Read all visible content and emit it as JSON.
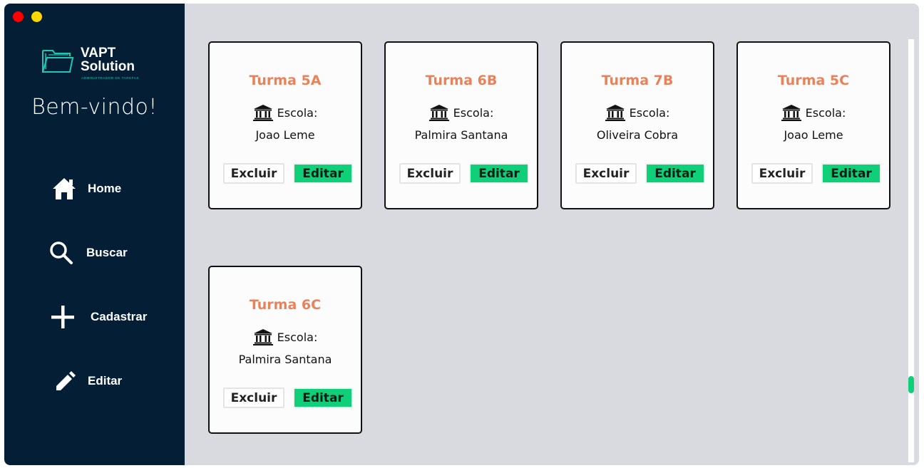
{
  "window": {
    "controls": [
      "close",
      "minimize"
    ]
  },
  "sidebar": {
    "logo": {
      "title_line1": "VAPT",
      "title_line2": "Solution",
      "subtitle": "ADMINISTRADOR DE TAREFAS",
      "icon": "folder-icon"
    },
    "welcome": "Bem-vindo!",
    "nav": [
      {
        "label": "Home",
        "icon": "home-icon"
      },
      {
        "label": "Buscar",
        "icon": "search-icon"
      },
      {
        "label": "Cadastrar",
        "icon": "plus-icon"
      },
      {
        "label": "Editar",
        "icon": "pencil-icon"
      }
    ]
  },
  "cards": [
    {
      "title": "Turma 5A",
      "escola_label": "Escola:",
      "school": "Joao Leme",
      "delete_label": "Excluir",
      "edit_label": "Editar"
    },
    {
      "title": "Turma 6B",
      "escola_label": "Escola:",
      "school": "Palmira Santana",
      "delete_label": "Excluir",
      "edit_label": "Editar"
    },
    {
      "title": "Turma 7B",
      "escola_label": "Escola:",
      "school": "Oliveira Cobra",
      "delete_label": "Excluir",
      "edit_label": "Editar"
    },
    {
      "title": "Turma 5C",
      "escola_label": "Escola:",
      "school": "Joao Leme",
      "delete_label": "Excluir",
      "edit_label": "Editar"
    },
    {
      "title": "Turma 6C",
      "escola_label": "Escola:",
      "school": "Palmira Santana",
      "delete_label": "Excluir",
      "edit_label": "Editar"
    }
  ],
  "colors": {
    "sidebar_bg": "#041e36",
    "content_bg": "#d8dae0",
    "card_title": "#e8825a",
    "edit_button": "#10cf79",
    "logo_accent": "#1fc7b3"
  }
}
